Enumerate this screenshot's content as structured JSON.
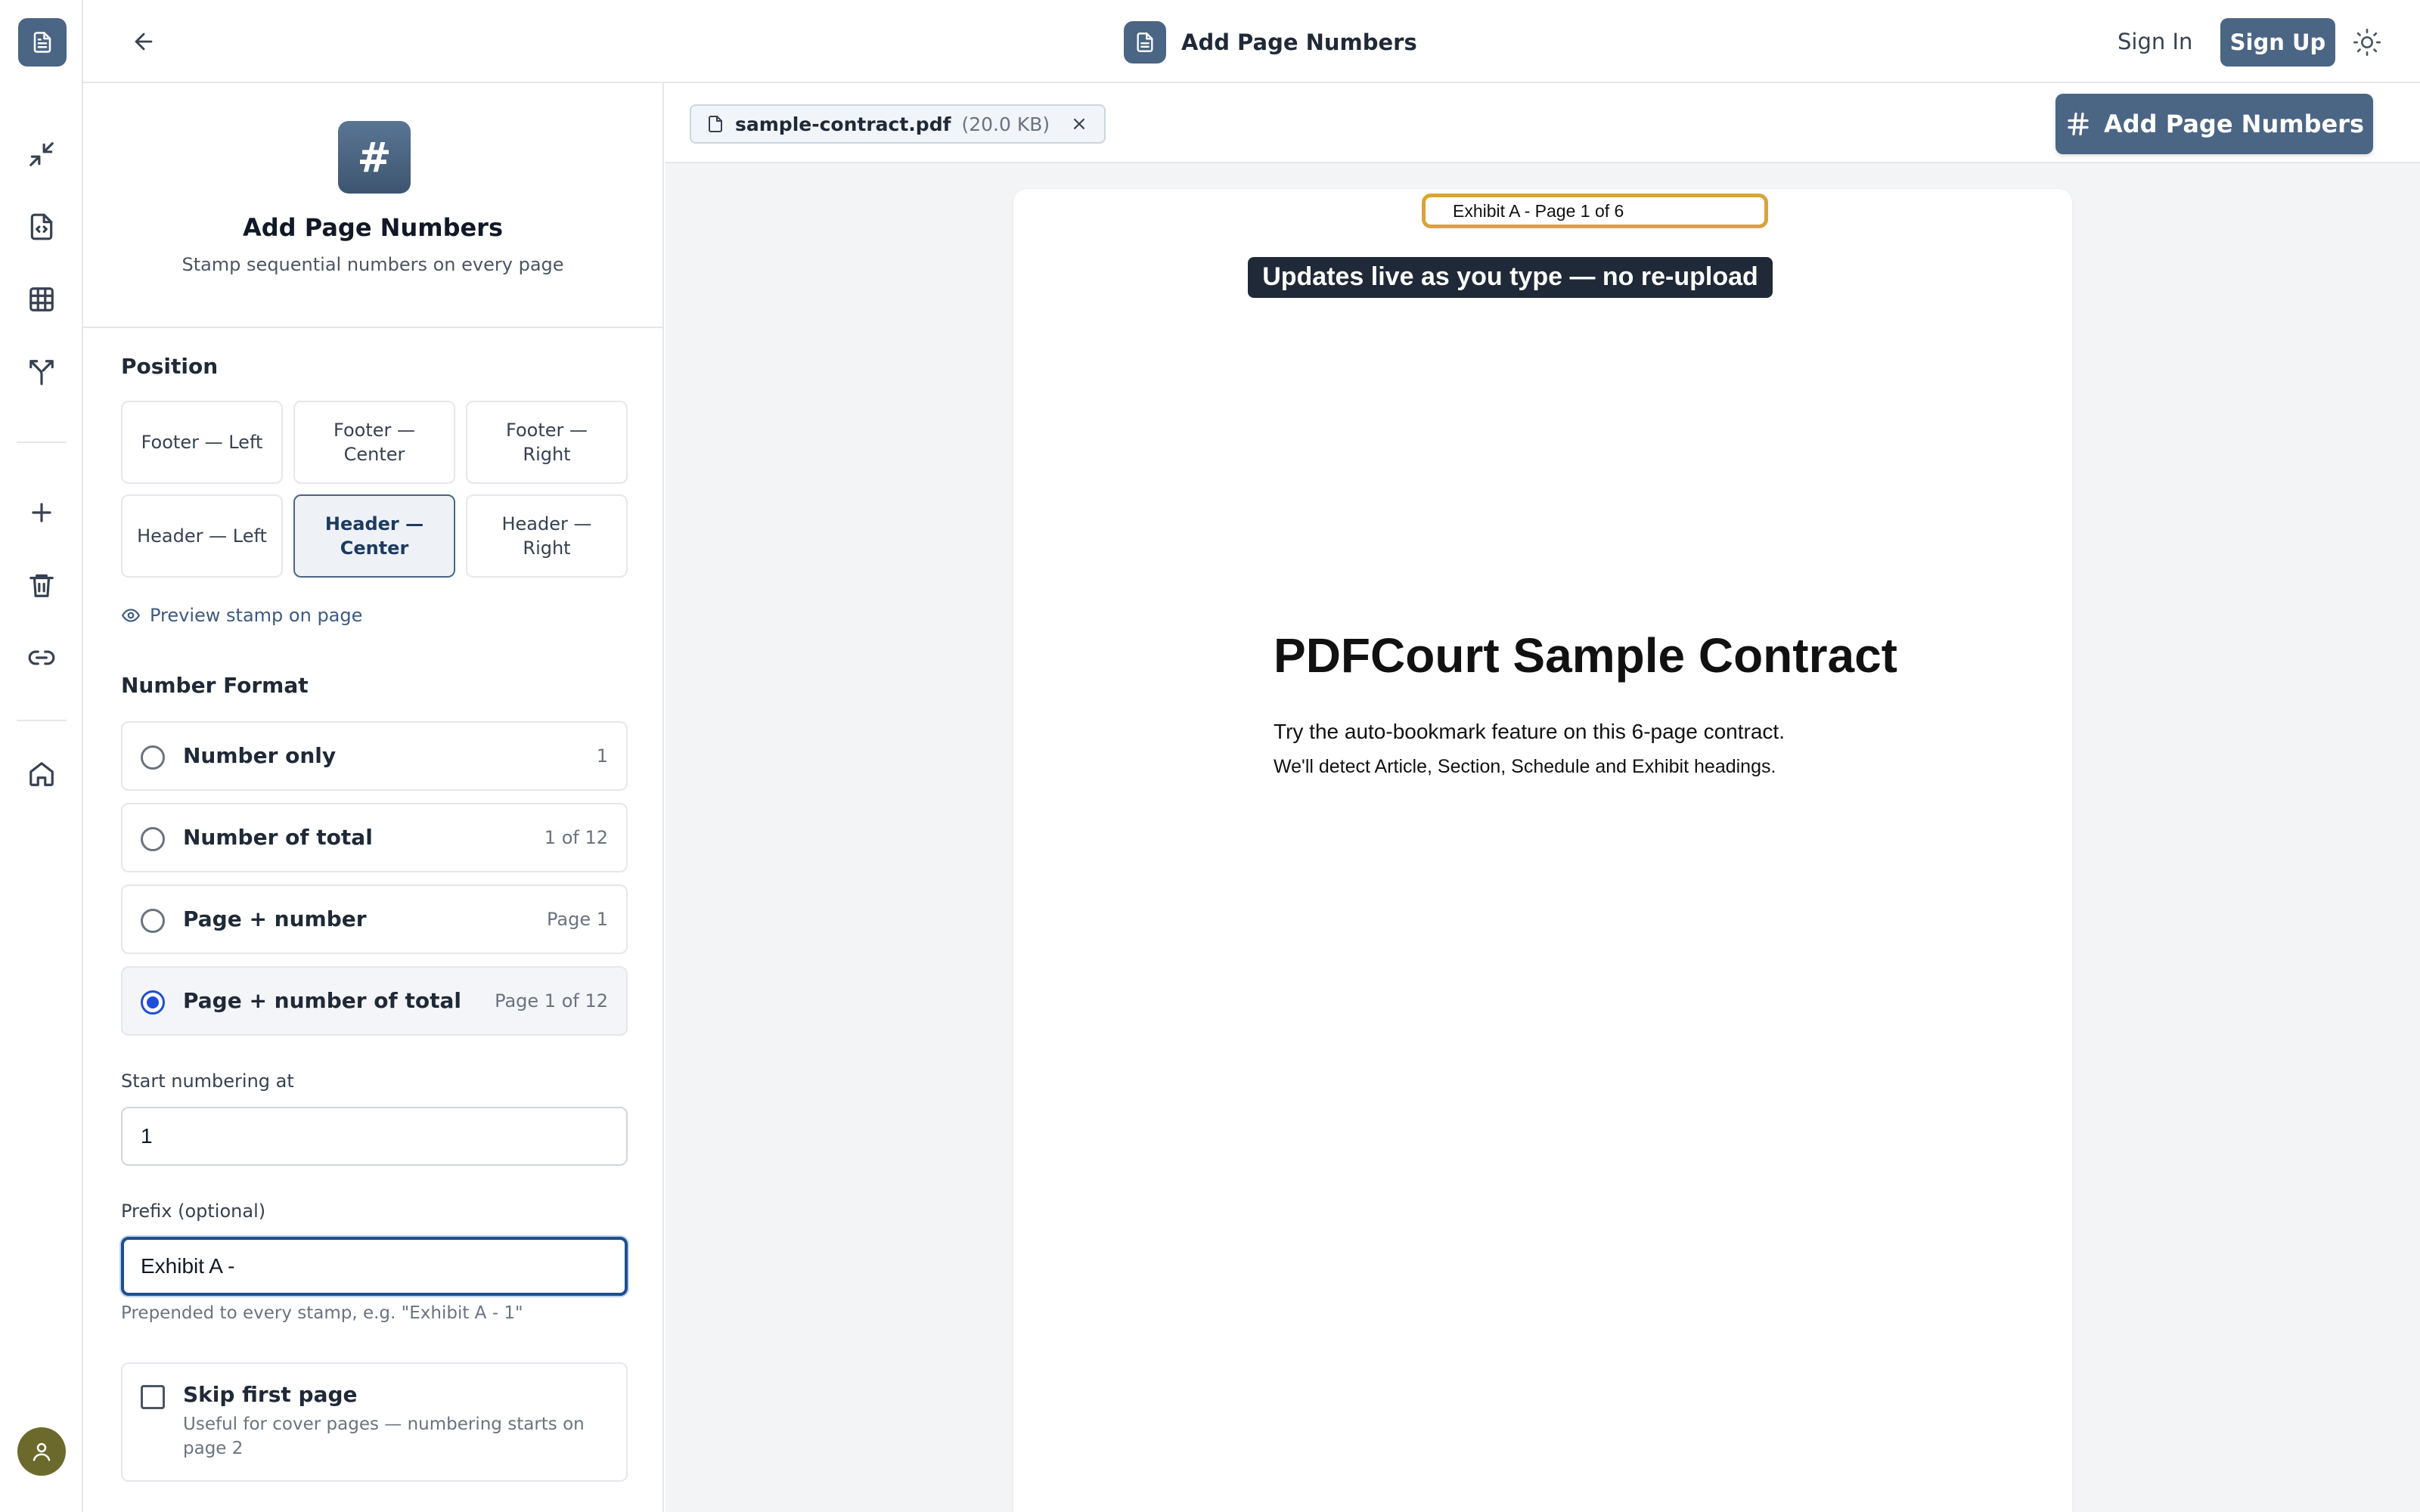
{
  "app": {
    "title": "Add Page Numbers"
  },
  "header": {
    "sign_in": "Sign In",
    "sign_up": "Sign Up"
  },
  "colors": {
    "brand": "#4b6584",
    "accent_focus": "#1e4e8c",
    "stamp_outline": "#d9a33a",
    "tooltip_bg": "#1f2937"
  },
  "rail": {
    "icons": [
      "file-text-icon",
      "compress-icon",
      "file-code-icon",
      "table-icon",
      "split-icon",
      "plus-icon",
      "trash-icon",
      "link-icon",
      "home-icon",
      "user-icon"
    ]
  },
  "panel": {
    "title": "Add Page Numbers",
    "subtitle": "Stamp sequential numbers on every page",
    "badge": "#",
    "position": {
      "label": "Position",
      "options": [
        "Footer — Left",
        "Footer — Center",
        "Footer — Right",
        "Header — Left",
        "Header — Center",
        "Header — Right"
      ],
      "selected": "Header — Center",
      "preview_link": "Preview stamp on page"
    },
    "format": {
      "label": "Number Format",
      "options": [
        {
          "label": "Number only",
          "example": "1"
        },
        {
          "label": "Number of total",
          "example": "1 of 12"
        },
        {
          "label": "Page + number",
          "example": "Page 1"
        },
        {
          "label": "Page + number of total",
          "example": "Page 1 of 12"
        }
      ],
      "selected": "Page + number of total"
    },
    "start": {
      "label": "Start numbering at",
      "value": "1"
    },
    "prefix": {
      "label": "Prefix (optional)",
      "value": "Exhibit A -",
      "help": "Prepended to every stamp, e.g. \"Exhibit A - 1\""
    },
    "skip": {
      "label": "Skip first page",
      "desc": "Useful for cover pages — numbering starts on page 2",
      "checked": false
    }
  },
  "file": {
    "name": "sample-contract.pdf",
    "size": "(20.0 KB)",
    "close": "×"
  },
  "action": {
    "label": "Add Page Numbers"
  },
  "preview": {
    "stamp": "Exhibit A - Page 1 of 6",
    "tooltip": "Updates live as you type — no re-upload",
    "doc_title": "PDFCourt Sample Contract",
    "line1": "Try the auto-bookmark feature on this 6-page contract.",
    "line2": "We'll detect Article, Section, Schedule and Exhibit headings."
  }
}
